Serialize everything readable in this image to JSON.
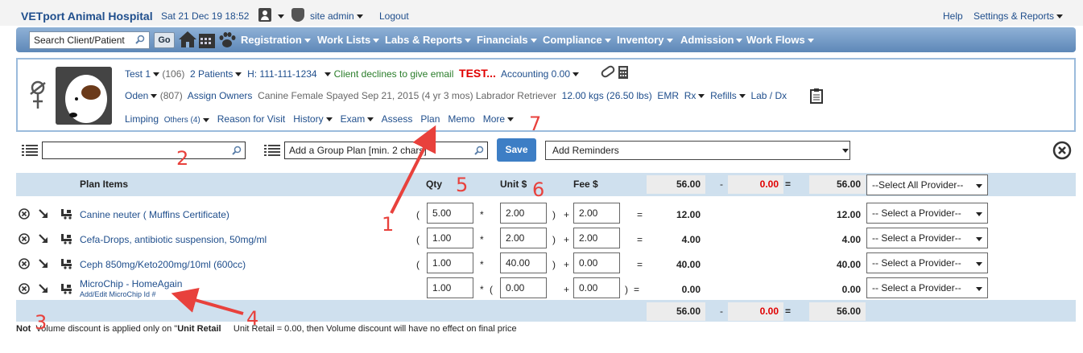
{
  "header": {
    "hospital_name": "VETport Animal Hospital",
    "datetime": "Sat 21 Dec 19 18:52",
    "user_label": "site admin",
    "logout_label": "Logout",
    "help_label": "Help",
    "settings_label": "Settings & Reports"
  },
  "nav": {
    "search_placeholder": "Search Client/Patient",
    "go_label": "Go",
    "items": [
      "Registration",
      "Work Lists",
      "Labs & Reports",
      "Financials",
      "Compliance",
      "Inventory",
      "Admission",
      "Work Flows"
    ]
  },
  "patient": {
    "row1": {
      "client": "Test 1",
      "client_id": "(106)",
      "patients": "2  Patients",
      "phone": "H: 111-111-1234",
      "email_status": "Client declines to give email",
      "alert": "TEST...",
      "accounting": "Accounting 0.00"
    },
    "row2": {
      "name": "Oden",
      "patient_id": "(807)",
      "assign": "Assign Owners",
      "details": "Canine  Female Spayed  Sep 21, 2015 (4 yr 3 mos)  Labrador Retriever",
      "weight": "12.00 kgs (26.50 lbs)",
      "emr": "EMR",
      "rx": "Rx",
      "refills": "Refills",
      "lab": "Lab / Dx"
    },
    "row3": {
      "limping": "Limping",
      "others": "Others (4)",
      "reason": "Reason for Visit",
      "history": "History",
      "exam": "Exam",
      "assess": "Assess",
      "plan": "Plan",
      "memo": "Memo",
      "more": "More"
    }
  },
  "controls": {
    "group_plan_placeholder": "Add a Group Plan [min. 2 chars]",
    "save_label": "Save",
    "reminders_label": "Add Reminders"
  },
  "table": {
    "headers": {
      "items": "Plan Items",
      "qty": "Qty",
      "unit": "Unit $",
      "fee": "Fee $"
    },
    "summary_top": {
      "subtotal": "56.00",
      "minus": "-",
      "discount": "0.00",
      "equals": "=",
      "total": "56.00",
      "provider_all": "--Select All Provider--"
    },
    "rows": [
      {
        "name": "Canine neuter ( Muffins Certificate)",
        "qty": "5.00",
        "unit": "2.00",
        "fee": "2.00",
        "amount": "12.00",
        "total": "12.00",
        "provider": "-- Select a Provider--"
      },
      {
        "name": "Cefa-Drops, antibiotic suspension, 50mg/ml",
        "qty": "1.00",
        "unit": "2.00",
        "fee": "2.00",
        "amount": "4.00",
        "total": "4.00",
        "provider": "-- Select a Provider--"
      },
      {
        "name": "Ceph 850mg/Keto200mg/10ml (600cc)",
        "qty": "1.00",
        "unit": "40.00",
        "fee": "0.00",
        "amount": "40.00",
        "total": "40.00",
        "provider": "-- Select a Provider--"
      },
      {
        "name": "MicroChip - HomeAgain",
        "sublink": "Add/Edit MicroChip Id #",
        "qty": "1.00",
        "unit": "0.00",
        "fee": "0.00",
        "amount": "0.00",
        "total": "0.00",
        "provider": "-- Select a Provider--"
      }
    ],
    "summary_bottom": {
      "subtotal": "56.00",
      "minus": "-",
      "discount": "0.00",
      "equals": "=",
      "total": "56.00"
    },
    "symbols": {
      "open": "(",
      "times": "*",
      "close": ")",
      "plus": "+",
      "eq": "="
    },
    "note_prefix": "Not",
    "note_bold": "Unit Retail",
    "note_start": "Volume discount is applied only on \"",
    "note_rest": "Unit Retail = 0.00, then Volume discount will have no effect on final price"
  },
  "annotations": [
    "1",
    "2",
    "3",
    "4",
    "5",
    "6",
    "7"
  ],
  "colors": {
    "accent": "#3d7ec5",
    "link": "#1f4e8c",
    "annotation": "#e8413c",
    "alert": "#e00000"
  }
}
